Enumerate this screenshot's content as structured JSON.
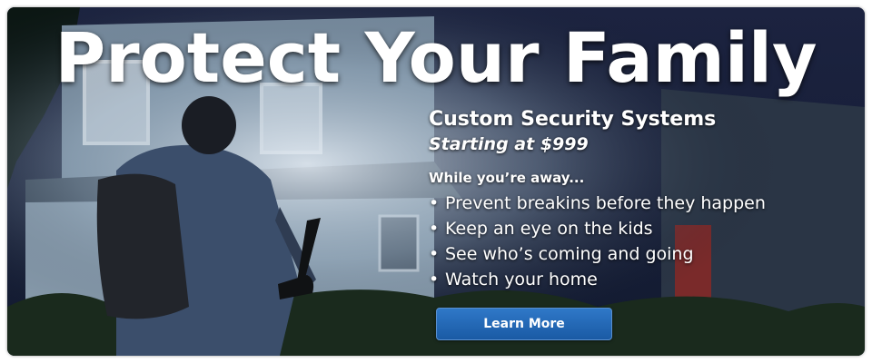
{
  "banner": {
    "headline": "Protect Your Family",
    "subtitle": "Custom Security Systems",
    "price": "Starting at $999",
    "intro": "While you’re away...",
    "bullets": [
      "Prevent breakins before they happen",
      "Keep an eye on the kids",
      "See who’s coming and going",
      "Watch your home"
    ],
    "bullet_glyph": "•",
    "cta_label": "Learn More"
  },
  "colors": {
    "accent": "#1f63b0",
    "text": "#ffffff",
    "night_sky": "#111a2f"
  },
  "image": {
    "subject": "burglar-with-flashlight-icon"
  }
}
